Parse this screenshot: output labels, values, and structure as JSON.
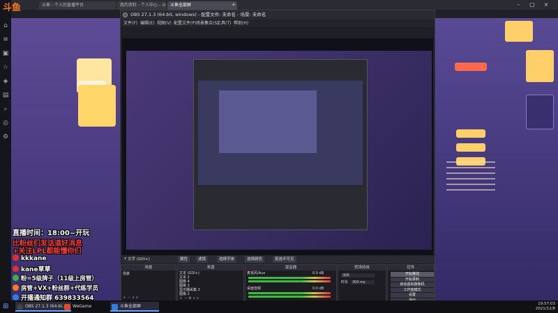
{
  "browser": {
    "tabs": [
      {
        "label": "斗鱼 - 个人的直播平台"
      },
      {
        "label": "我的资料 - 个人中心 - 斗鱼"
      },
      {
        "label": "斗鱼全部屏"
      }
    ],
    "logo": "斗鱼"
  },
  "obs": {
    "title": "OBS 27.1.3 (64-bit, windows) - 配置文件: 未命名 - 场景: 未命名",
    "menu": [
      "文件(F)",
      "编辑(E)",
      "视图(V)",
      "配置文件(P)",
      "场景集合(S)",
      "工具(T)",
      "帮助(H)"
    ],
    "toolbar": {
      "source_label": "文字 (GDI+)",
      "properties": "属性",
      "filters": "滤镜",
      "select_font": "选择字体",
      "select_color": "选择颜色",
      "not_visible": "复选不可见"
    },
    "docks": {
      "scenes": {
        "title": "场景",
        "items": [
          "场景"
        ]
      },
      "sources": {
        "title": "来源",
        "items": [
          "文本 (GDI+)",
          "文本 2",
          "图像 4",
          "图像 3",
          "显示器采集 2",
          "图像 2"
        ]
      },
      "mixer": {
        "title": "混音器",
        "channels": [
          {
            "name": "麦克风/Aux",
            "value": "0.0 dB"
          },
          {
            "name": "桌面音频",
            "value": "0.0 dB"
          }
        ]
      },
      "transitions": {
        "title": "转场特效",
        "type": "淡出",
        "duration_label": "时长",
        "duration": "300 ms"
      },
      "controls": {
        "title": "控件",
        "buttons": [
          "开始推流",
          "开始录制",
          "启动虚拟摄像机",
          "工作室模式",
          "设置",
          "退出"
        ]
      }
    }
  },
  "overlay": {
    "line1": "直播时间：18:00~开玩",
    "line2": "比粉丝们发话道好消息",
    "line3": "+关注LPL都能懂你们",
    "line4": "kkkane",
    "line5": "kane草草",
    "line6": "粉=5级牌子（11级上房管）",
    "line7": "房管+VX+粉丝群+代练学员",
    "line8": "开播通知群 639833564"
  },
  "taskbar": {
    "tasks": [
      "OBS 27.1.3 (64-bi...",
      "WeGame",
      "斗鱼全部屏"
    ],
    "time": "19:57:03",
    "date": "2021/12/8"
  },
  "colors": {
    "accent": "#ff7a1a",
    "obs_bg": "#1f1f26",
    "overlay_red": "#ff3b3b"
  }
}
